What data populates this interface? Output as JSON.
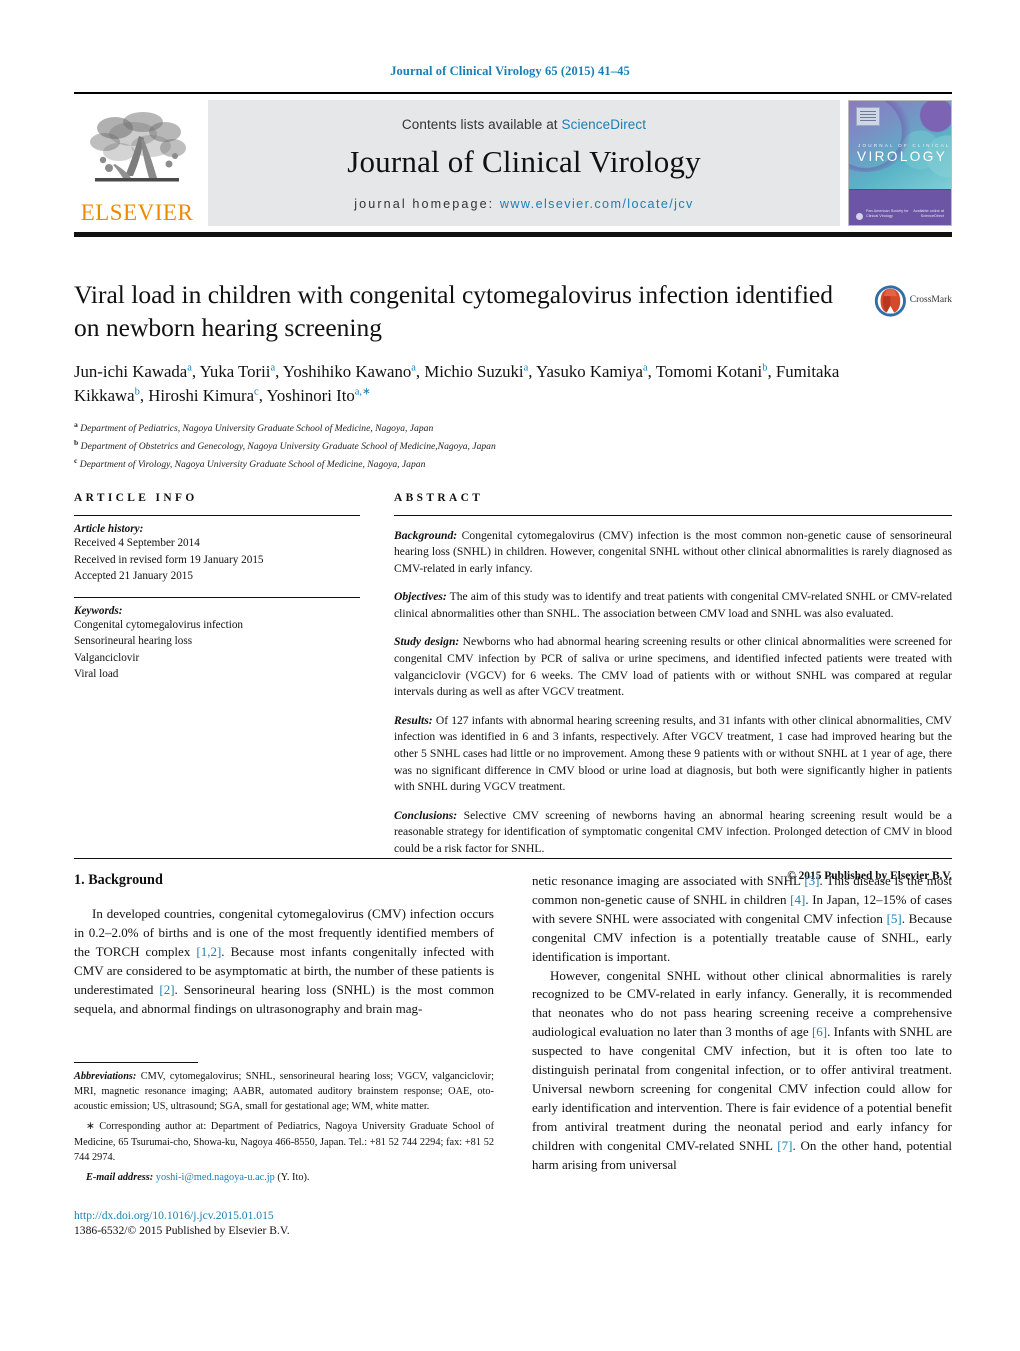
{
  "running_head": "Journal of Clinical Virology 65 (2015) 41–45",
  "masthead": {
    "publisher_logo_text": "ELSEVIER",
    "contents_prefix": "Contents lists available at ",
    "contents_link": "ScienceDirect",
    "journal_title": "Journal of Clinical Virology",
    "homepage_prefix": "journal homepage: ",
    "homepage_url": "www.elsevier.com/locate/jcv",
    "cover": {
      "superline": "JOURNAL OF CLINICAL",
      "mainline": "VIROLOGY",
      "footer_left": "Pan American Society for\nClinical Virology",
      "footer_right": "Available online at\nScienceDirect"
    },
    "link_color": "#1a7fb5",
    "elsevier_orange": "#ED8B00"
  },
  "article": {
    "title": "Viral load in children with congenital cytomegalovirus infection identified on newborn hearing screening",
    "crossmark_label": "CrossMark",
    "authors_html": "Jun-ichi Kawada<sup>a</sup>, Yuka Torii<sup>a</sup>, Yoshihiko Kawano<sup>a</sup>, Michio Suzuki<sup>a</sup>, Yasuko Kamiya<sup>a</sup>, Tomomi Kotani<sup>b</sup>, Fumitaka Kikkawa<sup>b</sup>, Hiroshi Kimura<sup>c</sup>, Yoshinori Ito<sup>a,∗</sup>",
    "affiliations": [
      {
        "marker": "a",
        "text": "Department of Pediatrics, Nagoya University Graduate School of Medicine, Nagoya, Japan"
      },
      {
        "marker": "b",
        "text": "Department of Obstetrics and Genecology, Nagoya University Graduate School of Medicine,Nagoya, Japan"
      },
      {
        "marker": "c",
        "text": "Department of Virology, Nagoya University Graduate School of Medicine, Nagoya, Japan"
      }
    ]
  },
  "article_info": {
    "heading": "ARTICLE INFO",
    "history_label": "Article history:",
    "history": [
      "Received 4 September 2014",
      "Received in revised form 19 January 2015",
      "Accepted 21 January 2015"
    ],
    "keywords_label": "Keywords:",
    "keywords": [
      "Congenital cytomegalovirus infection",
      "Sensorineural hearing loss",
      "Valganciclovir",
      "Viral load"
    ]
  },
  "abstract": {
    "heading": "ABSTRACT",
    "sections": [
      {
        "lead": "Background:",
        "text": " Congenital cytomegalovirus (CMV) infection is the most common non-genetic cause of sensorineural hearing loss (SNHL) in children. However, congenital SNHL without other clinical abnormalities is rarely diagnosed as CMV-related in early infancy."
      },
      {
        "lead": "Objectives:",
        "text": " The aim of this study was to identify and treat patients with congenital CMV-related SNHL or CMV-related clinical abnormalities other than SNHL. The association between CMV load and SNHL was also evaluated."
      },
      {
        "lead": "Study design:",
        "text": " Newborns who had abnormal hearing screening results or other clinical abnormalities were screened for congenital CMV infection by PCR of saliva or urine specimens, and identified infected patients were treated with valganciclovir (VGCV) for 6 weeks. The CMV load of patients with or without SNHL was compared at regular intervals during as well as after VGCV treatment."
      },
      {
        "lead": "Results:",
        "text": " Of 127 infants with abnormal hearing screening results, and 31 infants with other clinical abnormalities, CMV infection was identified in 6 and 3 infants, respectively. After VGCV treatment, 1 case had improved hearing but the other 5 SNHL cases had little or no improvement. Among these 9 patients with or without SNHL at 1 year of age, there was no significant difference in CMV blood or urine load at diagnosis, but both were significantly higher in patients with SNHL during VGCV treatment."
      },
      {
        "lead": "Conclusions:",
        "text": " Selective CMV screening of newborns having an abnormal hearing screening result would be a reasonable strategy for identification of symptomatic congenital CMV infection. Prolonged detection of CMV in blood could be a risk factor for SNHL."
      }
    ],
    "copyright": "© 2015 Published by Elsevier B.V."
  },
  "body": {
    "section_heading": "1.  Background",
    "left_paragraph_html": "In developed countries,  congenital cytomegalovirus (CMV) infection occurs in 0.2–2.0% of births and is one of the most frequently identified members of the TORCH complex <span class=\"ref\">[1,2]</span>. Because most infants congenitally infected with CMV are considered to be asymptomatic at birth, the number of these patients is underestimated <span class=\"ref\">[2]</span>. Sensorineural hearing loss (SNHL) is the most common sequela, and abnormal findings on ultrasonography and brain mag-",
    "right_paragraph_1_html": "netic resonance imaging are associated with SNHL <span class=\"ref\">[3]</span>. This disease is the most common non-genetic cause of SNHL in children <span class=\"ref\">[4]</span>. In Japan, 12–15% of cases with severe SNHL were associated with congenital CMV infection <span class=\"ref\">[5]</span>. Because congenital CMV infection is a potentially treatable cause of SNHL, early identification is important.",
    "right_paragraph_2_html": "However, congenital SNHL without other clinical abnormalities is rarely recognized to be CMV-related in early infancy. Generally, it is recommended that neonates who do not pass hearing screening receive a comprehensive audiological evaluation no later than 3 months of age <span class=\"ref\">[6]</span>. Infants with SNHL are suspected to have congenital CMV infection, but it is often too late to distinguish perinatal from congenital infection, or to offer antiviral treatment. Universal newborn screening for congenital CMV infection could allow for early identification and intervention. There is fair evidence of a potential benefit from antiviral treatment during the neonatal period and early infancy for children with congenital CMV-related SNHL <span class=\"ref\">[7]</span>. On the other hand, potential harm arising from universal"
  },
  "footnotes": {
    "abbrev_label": "Abbreviations:",
    "abbrev_text": " CMV, cytomegalovirus; SNHL, sensorineural hearing loss; VGCV, valganciclovir; MRI, magnetic resonance imaging; AABR, automated auditory brainstem response; OAE, oto-acoustic emission; US, ultrasound; SGA, small for gestational age; WM, white matter.",
    "corresponding_text": "∗ Corresponding author at: Department of Pediatrics, Nagoya University Graduate School of Medicine, 65 Tsurumai-cho, Showa-ku, Nagoya 466-8550, Japan. Tel.: +81 52 744 2294; fax: +81 52 744 2974.",
    "email_label": "E-mail address:",
    "email_link": "yoshi-i@med.nagoya-u.ac.jp",
    "email_suffix": " (Y. Ito)."
  },
  "footer": {
    "doi": "http://dx.doi.org/10.1016/j.jcv.2015.01.015",
    "issn_line": "1386-6532/© 2015 Published by Elsevier B.V."
  }
}
